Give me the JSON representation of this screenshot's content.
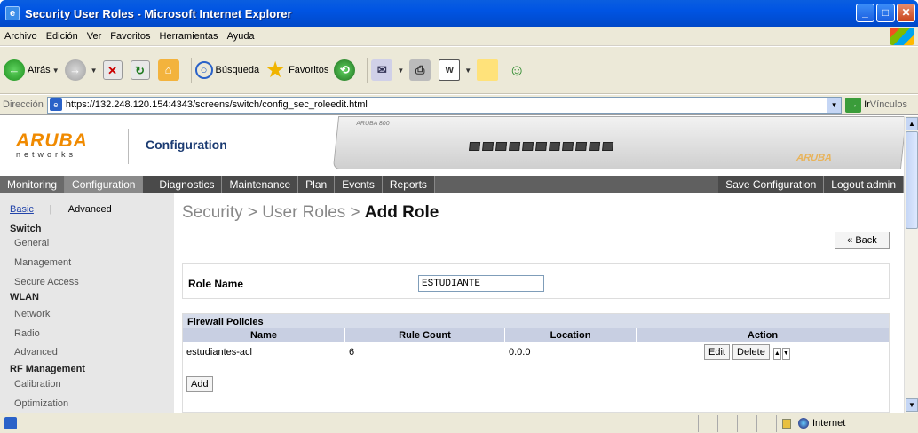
{
  "window": {
    "title": "Security User Roles - Microsoft Internet Explorer"
  },
  "menu": [
    "Archivo",
    "Edición",
    "Ver",
    "Favoritos",
    "Herramientas",
    "Ayuda"
  ],
  "toolbar": {
    "back_label": "Atrás",
    "search_label": "Búsqueda",
    "favorites_label": "Favoritos"
  },
  "address": {
    "label": "Dirección",
    "url": "https://132.248.120.154:4343/screens/switch/config_sec_roleedit.html",
    "go_label": "Ir",
    "links_label": "Vínculos"
  },
  "brand": {
    "logo_text": "ARUBA",
    "logo_sub": "networks",
    "section_title": "Configuration",
    "device_model": "ARUBA 800",
    "device_logo": "ARUBA"
  },
  "nav": {
    "tabs": [
      "Monitoring",
      "Configuration",
      "Diagnostics",
      "Maintenance",
      "Plan",
      "Events",
      "Reports"
    ],
    "save_label": "Save Configuration",
    "logout_label": "Logout admin"
  },
  "sidebar": {
    "basic_label": "Basic",
    "separator": "|",
    "advanced_label": "Advanced",
    "switch_head": "Switch",
    "switch_items": [
      "General",
      "Management",
      "Secure Access"
    ],
    "wlan_head": "WLAN",
    "wlan_items": [
      "Network",
      "Radio",
      "Advanced"
    ],
    "rf_head": "RF Management",
    "rf_items": [
      "Calibration",
      "Optimization"
    ]
  },
  "content": {
    "breadcrumb_prefix": "Security > User Roles > ",
    "breadcrumb_current": "Add Role",
    "back_label": "« Back",
    "role_name_label": "Role Name",
    "role_name_value": "ESTUDIANTE",
    "firewall_head": "Firewall Policies",
    "columns": [
      "Name",
      "Rule Count",
      "Location",
      "Action"
    ],
    "rows": [
      {
        "name": "estudiantes-acl",
        "rule_count": "6",
        "location": "0.0.0"
      }
    ],
    "edit_label": "Edit",
    "delete_label": "Delete",
    "add_label": "Add"
  },
  "status": {
    "zone": "Internet"
  }
}
